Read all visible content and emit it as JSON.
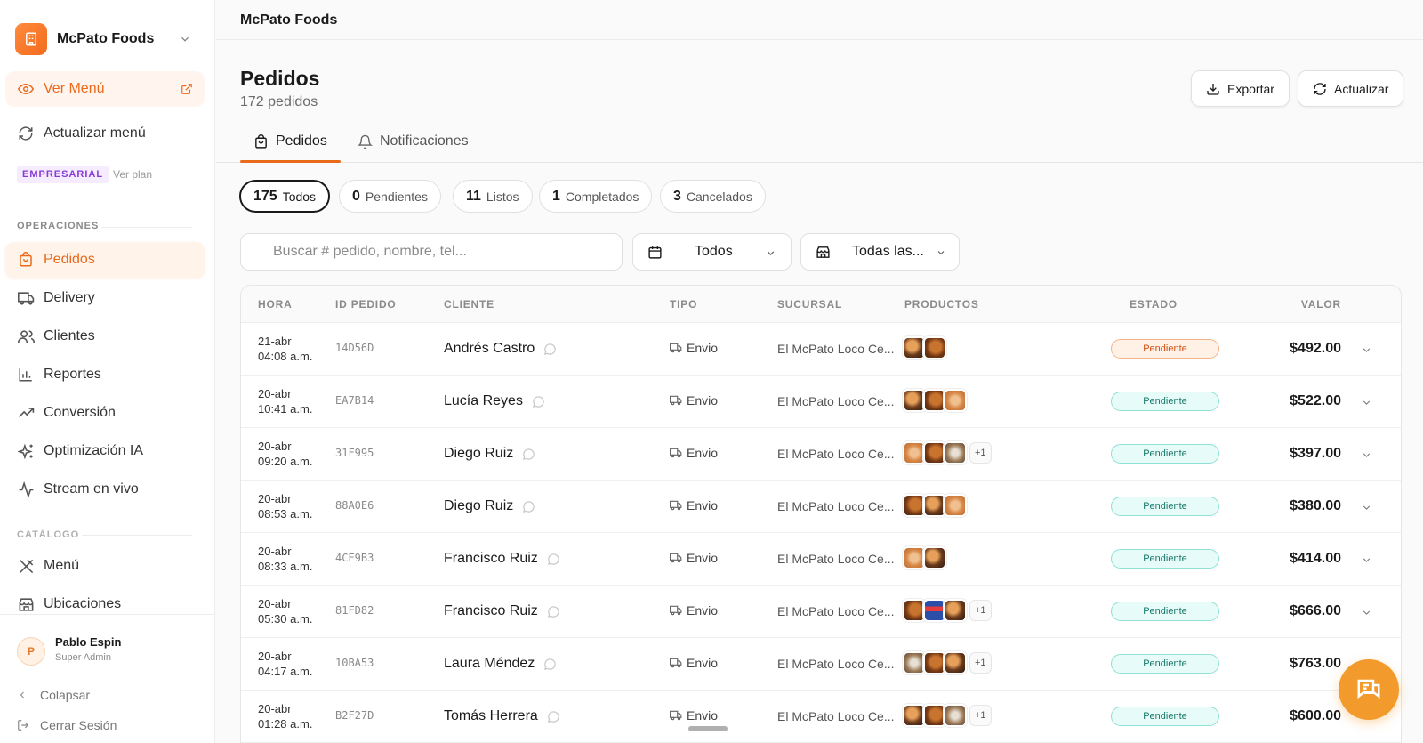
{
  "brand": {
    "name": "McPato Foods"
  },
  "sidebar": {
    "view_menu": "Ver Menú",
    "update_menu": "Actualizar menú",
    "plan_badge": "EMPRESARIAL",
    "plan_link": "Ver plan",
    "section_operations": "OPERACIONES",
    "section_catalog": "CATÁLOGO",
    "items": [
      {
        "label": "Pedidos",
        "icon": "bag-icon",
        "active": true
      },
      {
        "label": "Delivery",
        "icon": "truck-icon"
      },
      {
        "label": "Clientes",
        "icon": "users-icon"
      },
      {
        "label": "Reportes",
        "icon": "bar-chart-icon"
      },
      {
        "label": "Conversión",
        "icon": "trend-icon"
      },
      {
        "label": "Optimización IA",
        "icon": "sparkles-icon"
      },
      {
        "label": "Stream en vivo",
        "icon": "activity-icon"
      }
    ],
    "catalog_items": [
      {
        "label": "Menú",
        "icon": "utensils-icon"
      },
      {
        "label": "Ubicaciones",
        "icon": "store-icon"
      }
    ],
    "user": {
      "initial": "P",
      "name": "Pablo Espin",
      "role": "Super Admin"
    },
    "collapse": "Colapsar",
    "logout": "Cerrar Sesión"
  },
  "topbar": {
    "title": "McPato Foods"
  },
  "header": {
    "title": "Pedidos",
    "subtitle": "172 pedidos",
    "export": "Exportar",
    "refresh": "Actualizar"
  },
  "tabs": [
    {
      "label": "Pedidos",
      "active": true
    },
    {
      "label": "Notificaciones"
    }
  ],
  "filters": [
    {
      "count": "175",
      "label": "Todos",
      "active": true
    },
    {
      "count": "0",
      "label": "Pendientes"
    },
    {
      "count": "11",
      "label": "Listos"
    },
    {
      "count": "1",
      "label": "Completados"
    },
    {
      "count": "3",
      "label": "Cancelados"
    }
  ],
  "search": {
    "placeholder": "Buscar # pedido, nombre, tel..."
  },
  "date_select": {
    "value": "Todos"
  },
  "branch_select": {
    "value": "Todas las..."
  },
  "table": {
    "headers": {
      "time": "HORA",
      "id": "ID PEDIDO",
      "client": "CLIENTE",
      "type": "TIPO",
      "branch": "SUCURSAL",
      "products": "PRODUCTOS",
      "status": "ESTADO",
      "value": "VALOR"
    },
    "rows": [
      {
        "date": "21-abr",
        "time": "04:08 a.m.",
        "id": "14D56D",
        "client": "Andrés Castro",
        "type": "Envio",
        "branch": "El McPato Loco Ce...",
        "thumbs": [
          "t1",
          "t2"
        ],
        "more": "",
        "status": "Pendiente",
        "status_color": "orange",
        "value": "$492.00"
      },
      {
        "date": "20-abr",
        "time": "10:41 a.m.",
        "id": "EA7B14",
        "client": "Lucía Reyes",
        "type": "Envio",
        "branch": "El McPato Loco Ce...",
        "thumbs": [
          "t1",
          "t2",
          "t3"
        ],
        "more": "",
        "status": "Pendiente",
        "status_color": "teal",
        "value": "$522.00"
      },
      {
        "date": "20-abr",
        "time": "09:20 a.m.",
        "id": "31F995",
        "client": "Diego Ruiz",
        "type": "Envio",
        "branch": "El McPato Loco Ce...",
        "thumbs": [
          "t3",
          "t2",
          "t4"
        ],
        "more": "+1",
        "status": "Pendiente",
        "status_color": "teal",
        "value": "$397.00"
      },
      {
        "date": "20-abr",
        "time": "08:53 a.m.",
        "id": "88A0E6",
        "client": "Diego Ruiz",
        "type": "Envio",
        "branch": "El McPato Loco Ce...",
        "thumbs": [
          "t2",
          "t1",
          "t3"
        ],
        "more": "",
        "status": "Pendiente",
        "status_color": "teal",
        "value": "$380.00"
      },
      {
        "date": "20-abr",
        "time": "08:33 a.m.",
        "id": "4CE9B3",
        "client": "Francisco Ruiz",
        "type": "Envio",
        "branch": "El McPato Loco Ce...",
        "thumbs": [
          "t3",
          "t1"
        ],
        "more": "",
        "status": "Pendiente",
        "status_color": "teal",
        "value": "$414.00"
      },
      {
        "date": "20-abr",
        "time": "05:30 a.m.",
        "id": "81FD82",
        "client": "Francisco Ruiz",
        "type": "Envio",
        "branch": "El McPato Loco Ce...",
        "thumbs": [
          "t2",
          "t5",
          "t1"
        ],
        "more": "+1",
        "status": "Pendiente",
        "status_color": "teal",
        "value": "$666.00"
      },
      {
        "date": "20-abr",
        "time": "04:17 a.m.",
        "id": "10BA53",
        "client": "Laura Méndez",
        "type": "Envio",
        "branch": "El McPato Loco Ce...",
        "thumbs": [
          "t4",
          "t2",
          "t1"
        ],
        "more": "+1",
        "status": "Pendiente",
        "status_color": "teal",
        "value": "$763.00"
      },
      {
        "date": "20-abr",
        "time": "01:28 a.m.",
        "id": "B2F27D",
        "client": "Tomás Herrera",
        "type": "Envio",
        "branch": "El McPato Loco Ce...",
        "thumbs": [
          "t1",
          "t2",
          "t4"
        ],
        "more": "+1",
        "status": "Pendiente",
        "status_color": "teal",
        "value": "$600.00"
      }
    ]
  },
  "colors": {
    "accent": "#ea6a1c",
    "fab": "#f39a2c",
    "plan": "#8a3ad6"
  }
}
